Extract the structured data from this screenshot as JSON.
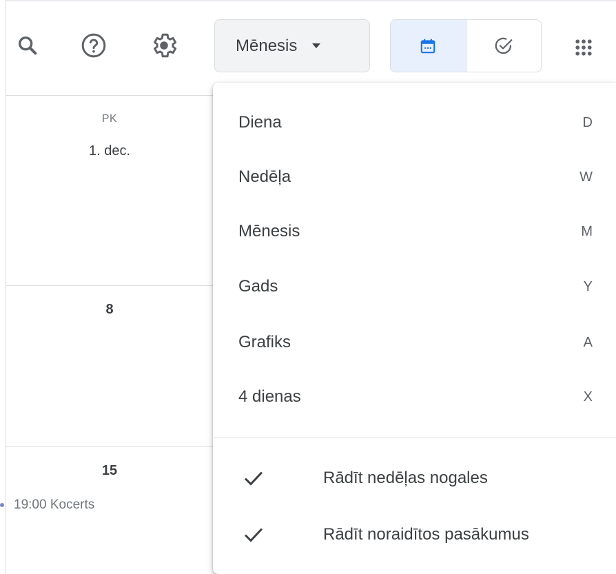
{
  "header": {
    "icons": {
      "search": "search-icon",
      "help": "help-icon",
      "settings": "gear-icon",
      "apps": "apps-grid-icon"
    },
    "view_select": {
      "label": "Mēnesis"
    },
    "toggle": {
      "calendar": "calendar-icon",
      "tasks": "task-check-icon"
    }
  },
  "calendar": {
    "column": {
      "dow": "PK",
      "date": "1. dec."
    },
    "week2": {
      "day": "8"
    },
    "week3": {
      "day": "15",
      "event": "19:00 Kocerts"
    }
  },
  "menu": {
    "items": [
      {
        "label": "Diena",
        "key": "D"
      },
      {
        "label": "Nedēļa",
        "key": "W"
      },
      {
        "label": "Mēnesis",
        "key": "M"
      },
      {
        "label": "Gads",
        "key": "Y"
      },
      {
        "label": "Grafiks",
        "key": "A"
      },
      {
        "label": "4 dienas",
        "key": "X"
      }
    ],
    "options": [
      {
        "label": "Rādīt nedēļas nogales",
        "checked": true
      },
      {
        "label": "Rādīt noraidītos pasākumus",
        "checked": true
      }
    ]
  },
  "colors": {
    "accent": "#1a73e8",
    "active_bg": "#e8f0fe",
    "divider": "#dadce0"
  }
}
